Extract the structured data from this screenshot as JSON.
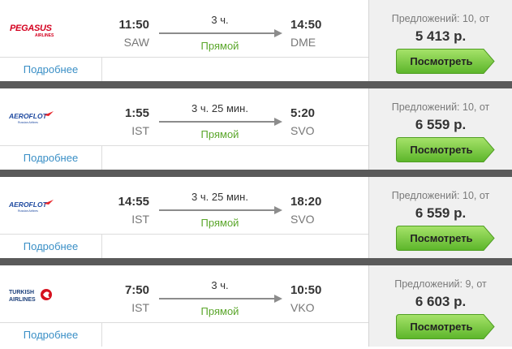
{
  "colors": {
    "price_panel_bg": "#f0f0f0",
    "separator": "#5a5a5a",
    "link": "#3a8fc6",
    "direct": "#5aa62a",
    "button_green": "#7fcf3c"
  },
  "flights": [
    {
      "airline_logo": "pegasus-airlines-logo",
      "dep_time": "11:50",
      "dep_code": "SAW",
      "duration": "3 ч.",
      "stops": "Прямой",
      "arr_time": "14:50",
      "arr_code": "DME",
      "offers": "Предложений: 10, от",
      "price": "5 413 р.",
      "button": "Посмотреть",
      "details": "Подробнее"
    },
    {
      "airline_logo": "aeroflot-logo",
      "dep_time": "1:55",
      "dep_code": "IST",
      "duration": "3 ч. 25 мин.",
      "stops": "Прямой",
      "arr_time": "5:20",
      "arr_code": "SVO",
      "offers": "Предложений: 10, от",
      "price": "6 559 р.",
      "button": "Посмотреть",
      "details": "Подробнее"
    },
    {
      "airline_logo": "aeroflot-logo",
      "dep_time": "14:55",
      "dep_code": "IST",
      "duration": "3 ч. 25 мин.",
      "stops": "Прямой",
      "arr_time": "18:20",
      "arr_code": "SVO",
      "offers": "Предложений: 10, от",
      "price": "6 559 р.",
      "button": "Посмотреть",
      "details": "Подробнее"
    },
    {
      "airline_logo": "turkish-airlines-logo",
      "dep_time": "7:50",
      "dep_code": "IST",
      "duration": "3 ч.",
      "stops": "Прямой",
      "arr_time": "10:50",
      "arr_code": "VKO",
      "offers": "Предложений: 9, от",
      "price": "6 603 р.",
      "button": "Посмотреть",
      "details": "Подробнее"
    }
  ]
}
